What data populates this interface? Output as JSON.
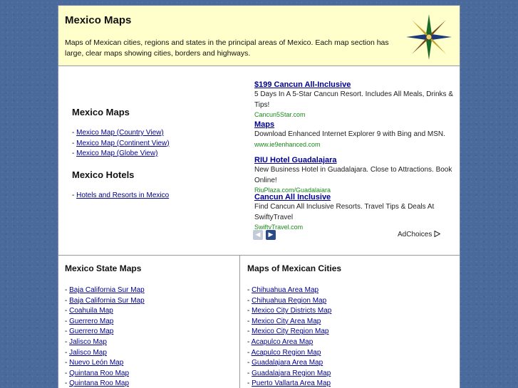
{
  "header": {
    "title": "Mexico Maps",
    "description": "Maps of Mexican cities, regions and states in the principal areas of Mexico. Each map section has large, clear maps showing cities, borders and highways."
  },
  "nav": {
    "maps_heading": "Mexico Maps",
    "maps_links": [
      "Mexico Map (Country View)",
      "Mexico Map (Continent View)",
      "Mexico Map (Globe View)"
    ],
    "hotels_heading": "Mexico Hotels",
    "hotels_links": [
      "Hotels and Resorts in Mexico"
    ],
    "bullet": "- "
  },
  "ads": [
    {
      "title": "$199 Cancun All-Inclusive",
      "desc": "5 Days In A 5-Star Cancun Resort. Includes All Meals, Drinks & Tips!",
      "url": "Cancun5Star.com"
    },
    {
      "title": "Maps",
      "desc": "Download Enhanced Internet Explorer 9 with Bing and MSN.",
      "url": "www.ie9enhanced.com"
    },
    {
      "title": "RIU Hotel Guadalajara",
      "desc": "New Business Hotel in Guadalajara. Close to Attractions. Book Online!",
      "url": "RiuPlaza.com/Guadalajara"
    },
    {
      "title": "Cancun All Inclusive",
      "desc": "Find Cancun All Inclusive Resorts. Travel Tips & Deals At SwiftyTravel",
      "url": "SwiftyTravel.com"
    }
  ],
  "ad_nav": {
    "prev": "◀",
    "next": "▶",
    "adchoices": "AdChoices"
  },
  "state_maps": {
    "heading": "Mexico State Maps",
    "links": [
      "Baja California Sur Map",
      "Baja California Sur Map",
      "Coahuila Map",
      "Guerrero Map",
      "Guerrero Map",
      "Jalisco Map",
      "Jalisco Map",
      "Nuevo León Map",
      "Quintana Roo Map",
      "Quintana Roo Map"
    ]
  },
  "city_maps": {
    "heading": "Maps of Mexican Cities",
    "links": [
      "Chihuahua Area Map",
      "Chihuahua Region Map",
      "Mexico City Districts Map",
      "Mexico City Area Map",
      "Mexico City Region Map",
      "Acapulco Area Map",
      "Acapulco Region Map",
      "Guadalajara Area Map",
      "Guadalajara Region Map",
      "Puerto Vallarta Area Map"
    ]
  },
  "colors": {
    "link": "#00008b",
    "header_bg": "#ffffcc",
    "ad_url": "#1a8a1a",
    "page_bg": "#4a6a9c"
  }
}
